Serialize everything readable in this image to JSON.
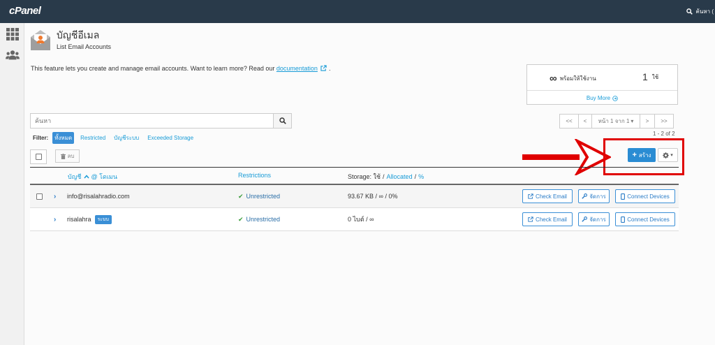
{
  "app": {
    "logo": "cPanel",
    "search_label": "ค้นหา ("
  },
  "page": {
    "title": "บัญชีอีเมล",
    "subtitle": "List Email Accounts"
  },
  "intro": {
    "text": "This feature lets you create and manage email accounts. Want to learn more? Read our ",
    "link": "documentation",
    "suffix": "."
  },
  "stats": {
    "available_symbol": "∞",
    "available_label": "พร้อมให้ใช้งาน",
    "used_count": "1",
    "used_label": "ใช้",
    "buy_more": "Buy More"
  },
  "search": {
    "placeholder": "ค้นหา"
  },
  "pagination": {
    "first": "<<",
    "prev": "<",
    "current": "หน้า 1 จาก 1",
    "next": ">",
    "last": ">>",
    "count": "1 - 2 of 2"
  },
  "filter": {
    "label": "Filter:",
    "options": [
      "ทั้งหมด",
      "Restricted",
      "บัญชีระบบ",
      "Exceeded Storage"
    ],
    "active_index": 0
  },
  "toolbar": {
    "delete_label": "ลบ",
    "create_label": "สร้าง"
  },
  "table": {
    "headers": {
      "account": "บัญชี",
      "domain": "@ โดเมน",
      "restrictions": "Restrictions",
      "storage_used": "Storage: ใช้",
      "storage_allocated": "Allocated",
      "storage_percent": "%"
    },
    "rows": [
      {
        "account": "info@risalahradio.com",
        "restriction": "Unrestricted",
        "storage": "93.67 KB / ∞ / 0%",
        "system": false
      },
      {
        "account": "risalahra",
        "badge": "ระบบ",
        "restriction": "Unrestricted",
        "storage": "0 ไบต์ / ∞",
        "system": true
      }
    ],
    "actions": {
      "check_email": "Check Email",
      "manage": "จัดการ",
      "connect_devices": "Connect Devices"
    }
  },
  "colors": {
    "topbar": "#293a4a",
    "accent": "#179bd7",
    "primary_button": "#2a8cd3",
    "highlight": "#e00000",
    "success": "#3c9d3c"
  }
}
